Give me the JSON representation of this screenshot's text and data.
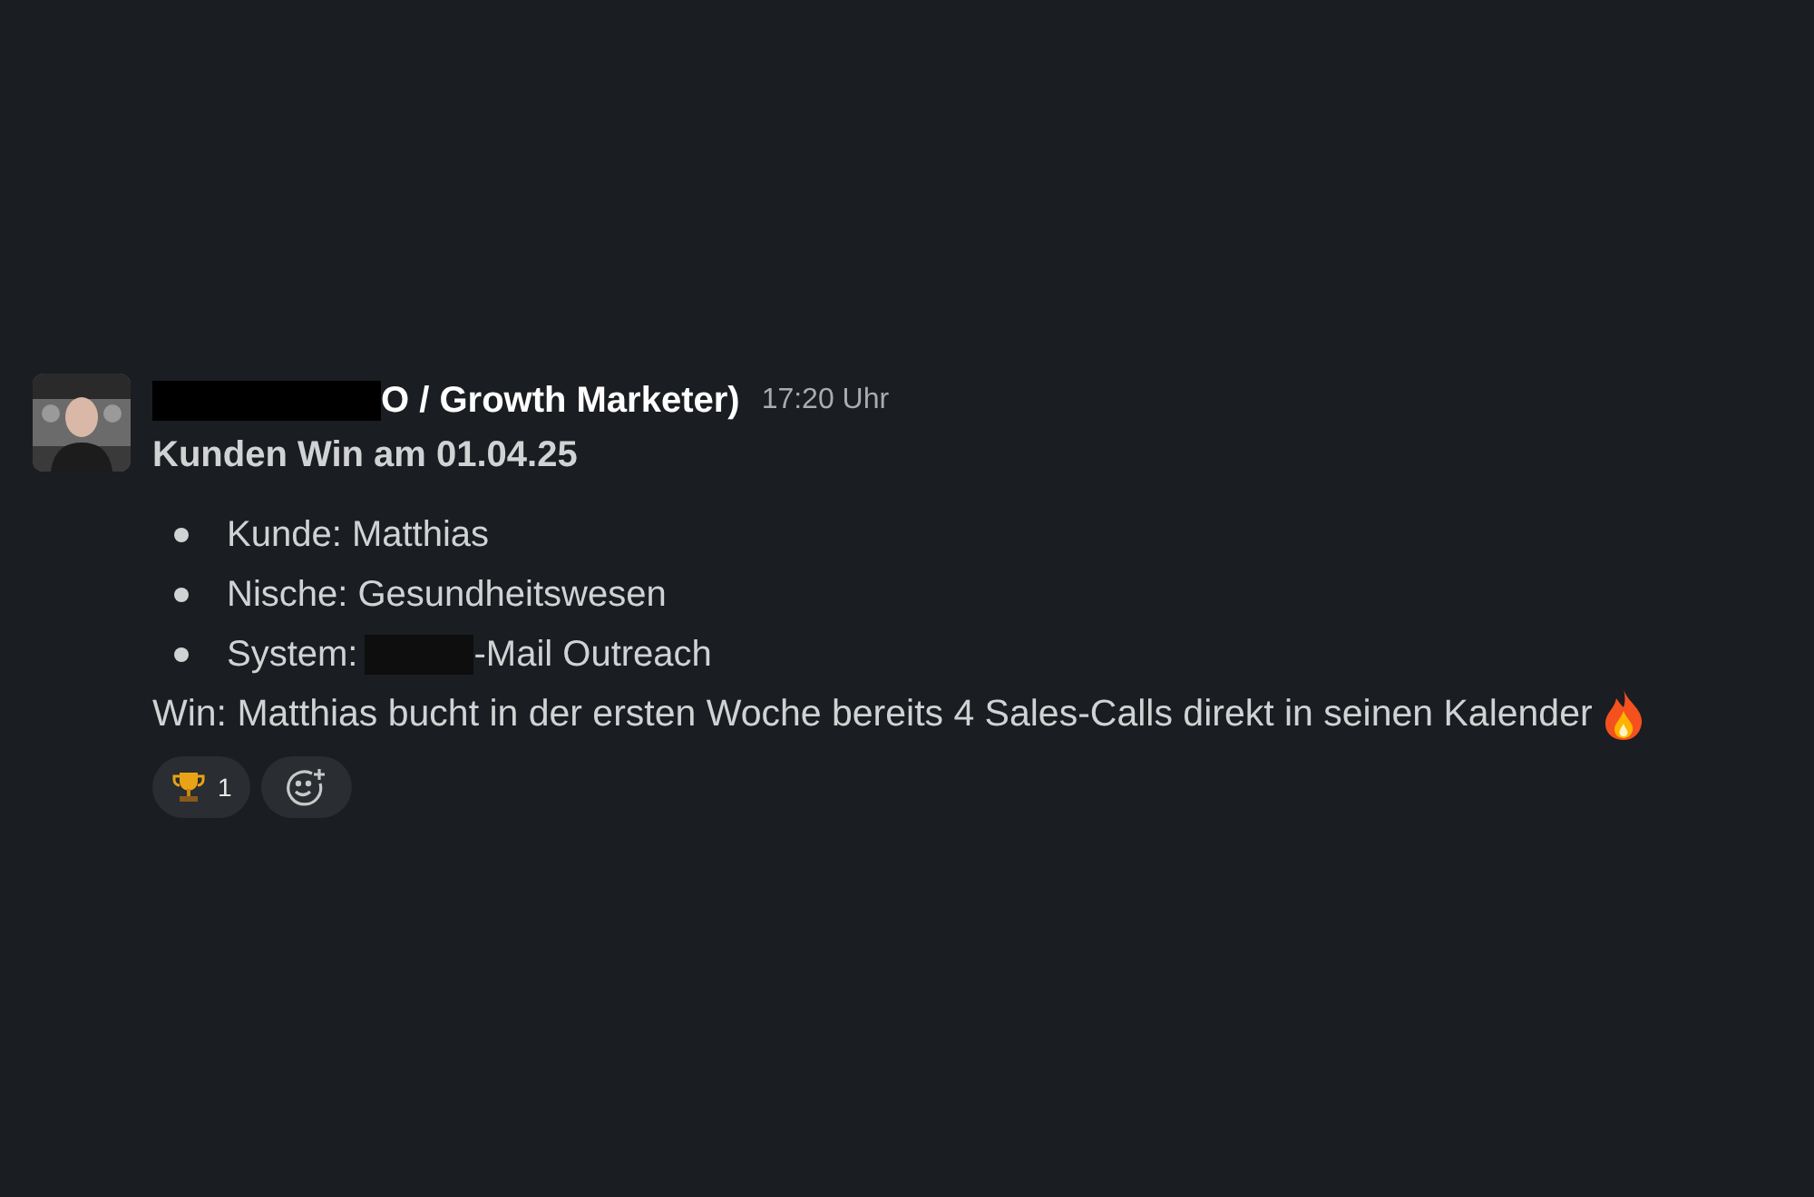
{
  "message": {
    "author_visible": "O / Growth Marketer)",
    "time": "17:20 Uhr",
    "title": "Kunden Win am 01.04.25",
    "bullets": [
      {
        "text": "Kunde: Matthias",
        "redacted": false
      },
      {
        "text": "Nische: Gesundheitswesen",
        "redacted": false
      },
      {
        "text": "System:",
        "redacted": true,
        "after": "-Mail Outreach"
      }
    ],
    "win": "Win: Matthias bucht in der ersten Woche bereits 4 Sales-Calls direkt in seinen Kalender",
    "reactions": [
      {
        "count": "1",
        "selected": false
      }
    ]
  }
}
